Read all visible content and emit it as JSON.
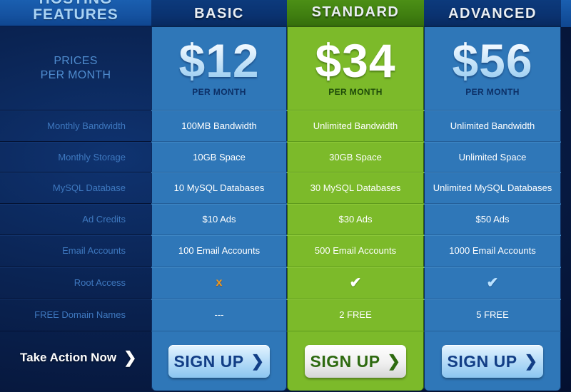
{
  "features_column": {
    "header_line1": "HOSTING",
    "header_line2": "FEATURES",
    "prices_label_line1": "PRICES",
    "prices_label_line2": "PER MONTH",
    "rows": [
      "Monthly Bandwidth",
      "Monthly Storage",
      "MySQL Database",
      "Ad Credits",
      "Email Accounts",
      "Root Access",
      "FREE Domain Names"
    ],
    "action_label": "Take Action Now",
    "action_icon": "chevron-right-icon"
  },
  "plans": [
    {
      "name": "BASIC",
      "price": "$12",
      "per": "PER MONTH",
      "theme": "blue",
      "accent": "#2f77b8",
      "rows": [
        "100MB Bandwidth",
        "10GB Space",
        "10 MySQL Databases",
        "$10 Ads",
        "100 Email Accounts",
        "",
        "---"
      ],
      "root_access": "cross-icon",
      "signup_label": "SIGN UP"
    },
    {
      "name": "STANDARD",
      "price": "$34",
      "per": "PER MONTH",
      "theme": "green",
      "accent": "#7cba2a",
      "rows": [
        "Unlimited  Bandwidth",
        "30GB Space",
        "30 MySQL Databases",
        "$30 Ads",
        "500 Email Accounts",
        "",
        "2 FREE"
      ],
      "root_access": "checkmark-icon",
      "signup_label": "SIGN UP"
    },
    {
      "name": "ADVANCED",
      "price": "$56",
      "per": "PER MONTH",
      "theme": "blue",
      "accent": "#2f77b8",
      "rows": [
        "Unlimited Bandwidth",
        "Unlimited Space",
        "Unlimited MySQL Databases",
        "$50 Ads",
        "1000 Email Accounts",
        "",
        "5 FREE"
      ],
      "root_access": "checkmark-icon",
      "signup_label": "SIGN UP"
    }
  ],
  "icons": {
    "cross": "x",
    "check": "✔",
    "chevron": "❯"
  }
}
